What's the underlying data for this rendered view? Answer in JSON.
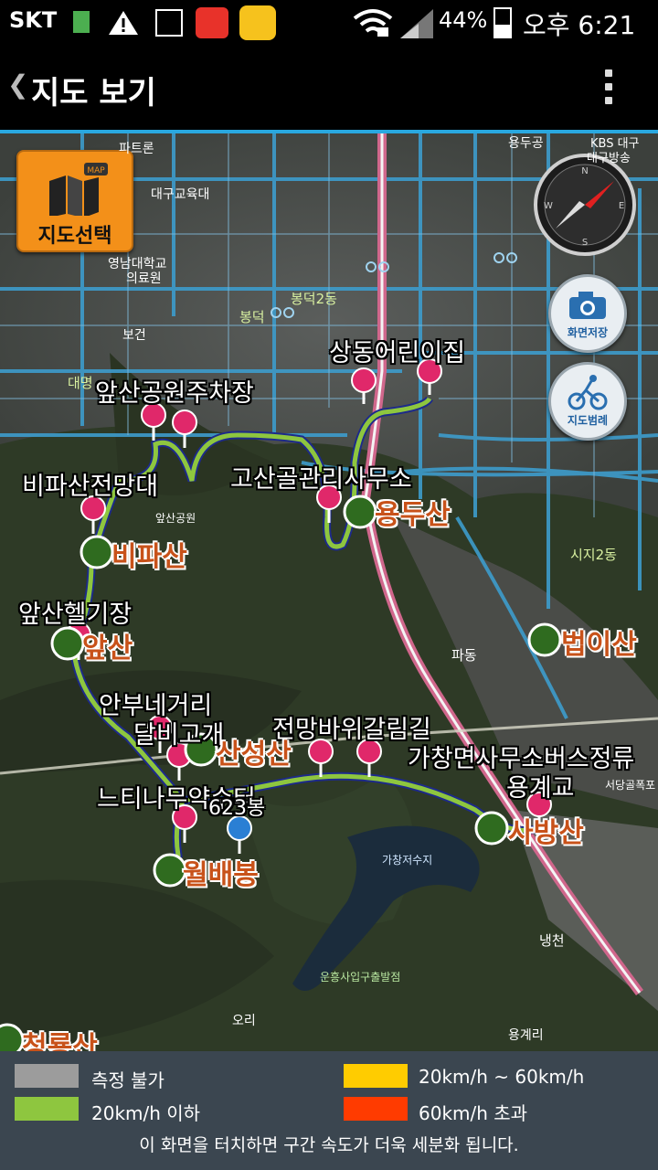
{
  "status_bar": {
    "carrier": "SKT",
    "battery_percent": "44%",
    "time": "오후 6:21",
    "icons": [
      "sim-icon",
      "warning-icon",
      "gallery-icon",
      "app-icon",
      "game-icon",
      "wifi-lock-icon",
      "signal-icon",
      "battery-icon"
    ]
  },
  "appbar": {
    "title": "지도 보기",
    "back_icon": "back-chevron-icon",
    "menu_icon": "overflow-menu-icon"
  },
  "map": {
    "select_button_label": "지도선택",
    "select_button_badge": "MAP",
    "screenshot_button_label": "화면저장",
    "map_legend_button_label": "지도범례",
    "waypoints": [
      {
        "label": "상동어린이집",
        "color": "#e0286a"
      },
      {
        "label": "앞산공원주차장",
        "color": "#e0286a"
      },
      {
        "label": "고산골관리사무소",
        "color": "#e0286a"
      },
      {
        "label": "비파산전망대",
        "color": "#e0286a"
      },
      {
        "label": "앞산헬기장",
        "color": "#e0286a"
      },
      {
        "label": "안부네거리",
        "color": "#e0286a"
      },
      {
        "label": "달비고개",
        "color": "#e0286a"
      },
      {
        "label": "전망바위갈림길",
        "color": "#e0286a"
      },
      {
        "label": "가창면사무소버스정류",
        "color": "#e0286a"
      },
      {
        "label": "용계교",
        "color": "#e0286a"
      },
      {
        "label": "느티나무약수터",
        "color": "#e0286a"
      },
      {
        "label": "623봉",
        "color": "#2a7fd4"
      }
    ],
    "peaks": [
      "용두산",
      "비파산",
      "앞산",
      "산성산",
      "법이산",
      "사방산",
      "월배봉",
      "청룡산"
    ],
    "place_labels": [
      "파트론",
      "대구교육대",
      "영남대학교",
      "의료원",
      "보건",
      "봉덕2동",
      "봉덕",
      "대명",
      "앞산공원",
      "파동",
      "시지2동",
      "서당골폭포",
      "가창저수지",
      "냉천",
      "오리",
      "용계리",
      "KBS 대구",
      "대구방송",
      "용두공",
      "운흥사입구출발점"
    ],
    "route_color": "#8ec63f"
  },
  "legend": {
    "items": [
      {
        "label": "측정 불가",
        "color": "#9c9c9c"
      },
      {
        "label": "20km/h ~ 60km/h",
        "color": "#ffcc00"
      },
      {
        "label": "20km/h 이하",
        "color": "#8ec63f"
      },
      {
        "label": "60km/h 초과",
        "color": "#ff3b00"
      }
    ],
    "notice": "이 화면을 터치하면 구간 속도가 더욱 세분화 됩니다."
  }
}
